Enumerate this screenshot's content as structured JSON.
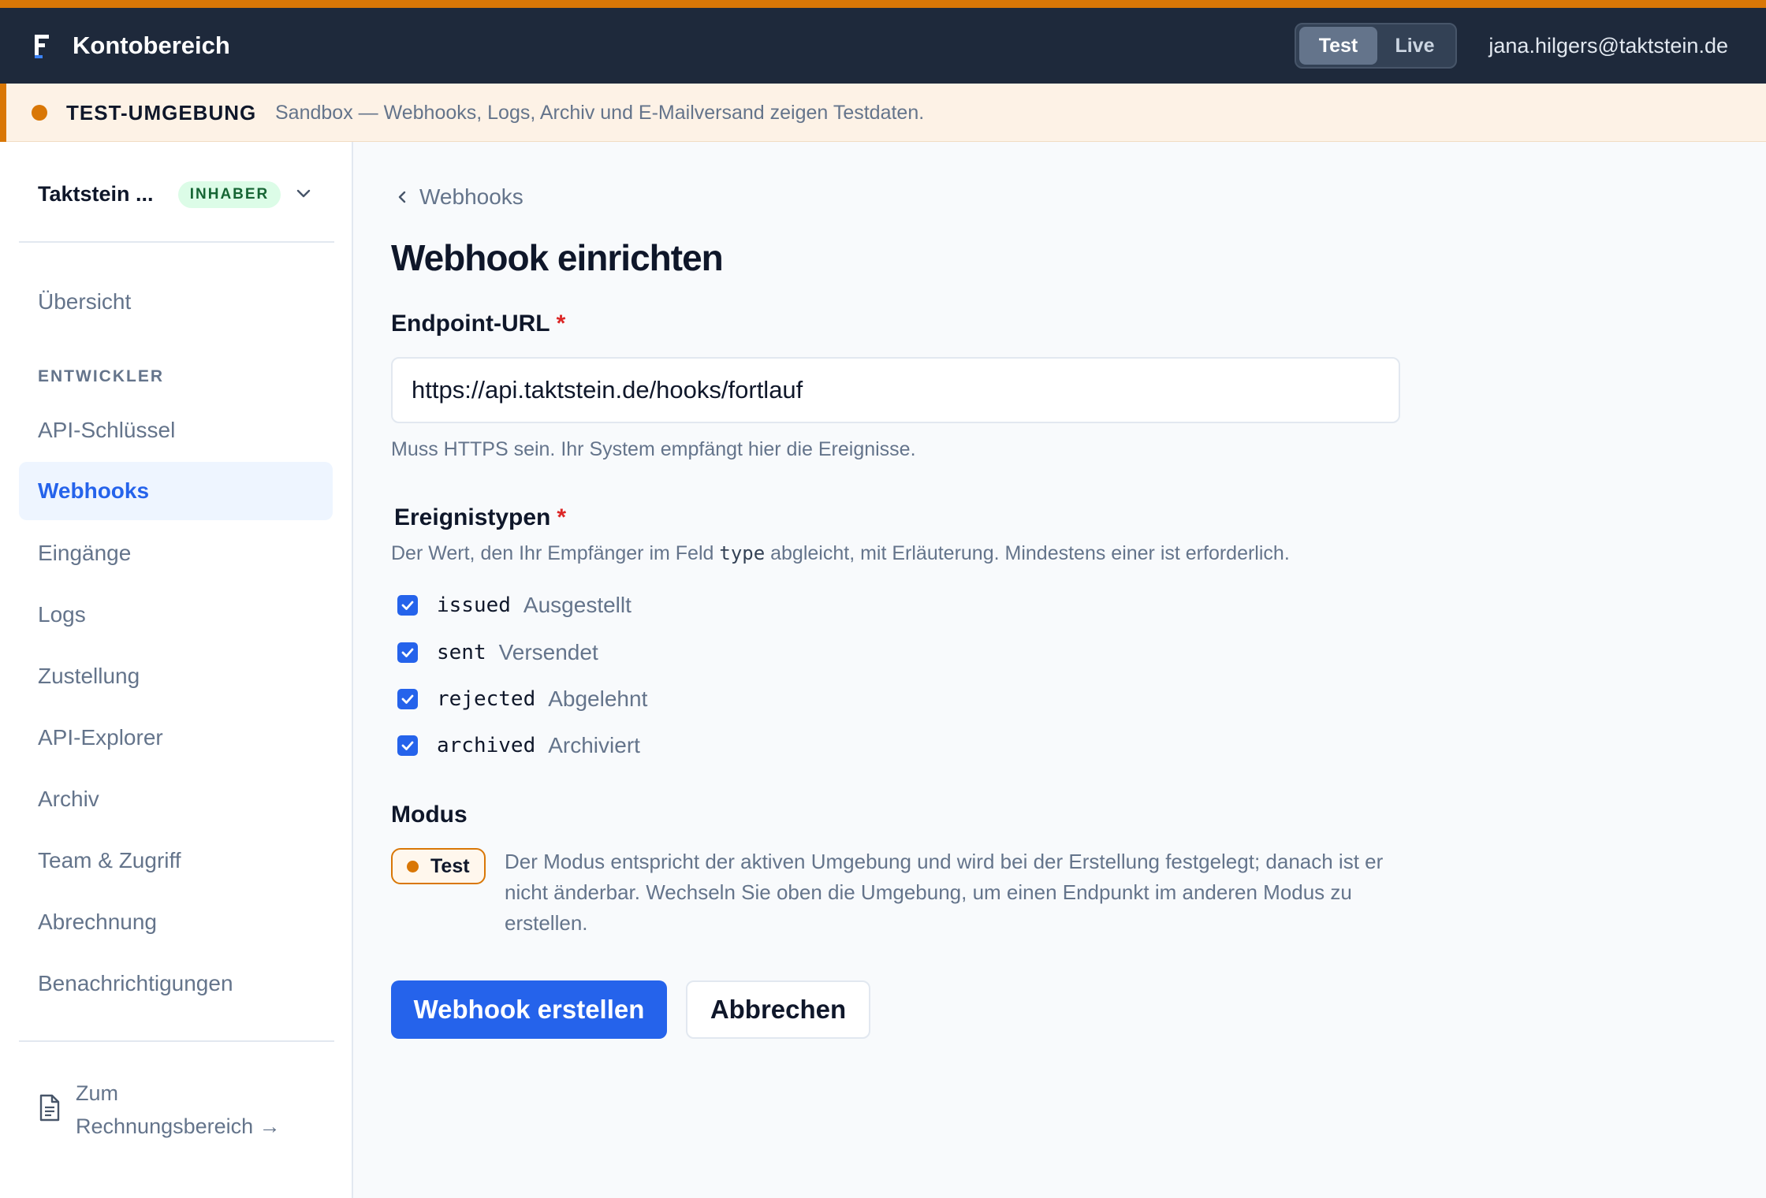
{
  "header": {
    "app_title": "Kontobereich",
    "env_options": [
      "Test",
      "Live"
    ],
    "env_active": "Test",
    "user_email": "jana.hilgers@taktstein.de",
    "logo_icon": "brand-logo-icon"
  },
  "banner": {
    "title": "TEST-UMGEBUNG",
    "text": "Sandbox — Webhooks, Logs, Archiv und E-Mailversand zeigen Testdaten."
  },
  "sidebar": {
    "org_name": "Taktstein ...",
    "org_role": "INHABER",
    "top_items": [
      {
        "label": "Übersicht"
      }
    ],
    "section_title": "ENTWICKLER",
    "items": [
      {
        "label": "API-Schlüssel"
      },
      {
        "label": "Webhooks",
        "active": true
      },
      {
        "label": "Eingänge"
      },
      {
        "label": "Logs"
      },
      {
        "label": "Zustellung"
      },
      {
        "label": "API-Explorer"
      },
      {
        "label": "Archiv"
      },
      {
        "label": "Team & Zugriff"
      },
      {
        "label": "Abrechnung"
      },
      {
        "label": "Benachrichtigungen"
      }
    ],
    "footer_link_line1": "Zum",
    "footer_link_line2": "Rechnungsbereich →"
  },
  "main": {
    "back_label": "Webhooks",
    "page_title": "Webhook einrichten",
    "endpoint": {
      "label": "Endpoint-URL",
      "required_mark": "*",
      "value": "https://api.taktstein.de/hooks/fortlauf",
      "help": "Muss HTTPS sein. Ihr System empfängt hier die Ereignisse."
    },
    "events": {
      "label": "Ereignistypen",
      "required_mark": "*",
      "help_before": "Der Wert, den Ihr Empfänger im Feld",
      "help_code": "type",
      "help_after": "abgleicht, mit Erläuterung. Mindestens einer ist erforderlich.",
      "options": [
        {
          "code": "issued",
          "desc": "Ausgestellt",
          "checked": true
        },
        {
          "code": "sent",
          "desc": "Versendet",
          "checked": true
        },
        {
          "code": "rejected",
          "desc": "Abgelehnt",
          "checked": true
        },
        {
          "code": "archived",
          "desc": "Archiviert",
          "checked": true
        }
      ]
    },
    "mode": {
      "label": "Modus",
      "value": "Test",
      "help": "Der Modus entspricht der aktiven Umgebung und wird bei der Erstellung festgelegt; danach ist er nicht änderbar. Wechseln Sie oben die Umgebung, um einen Endpunkt im anderen Modus zu erstellen."
    },
    "submit_label": "Webhook erstellen",
    "cancel_label": "Abbrechen"
  },
  "colors": {
    "accent": "#d97706",
    "primary": "#2563eb",
    "header_bg": "#1e293b",
    "banner_bg": "#fdf2e6",
    "badge_bg": "#dcfce7"
  }
}
